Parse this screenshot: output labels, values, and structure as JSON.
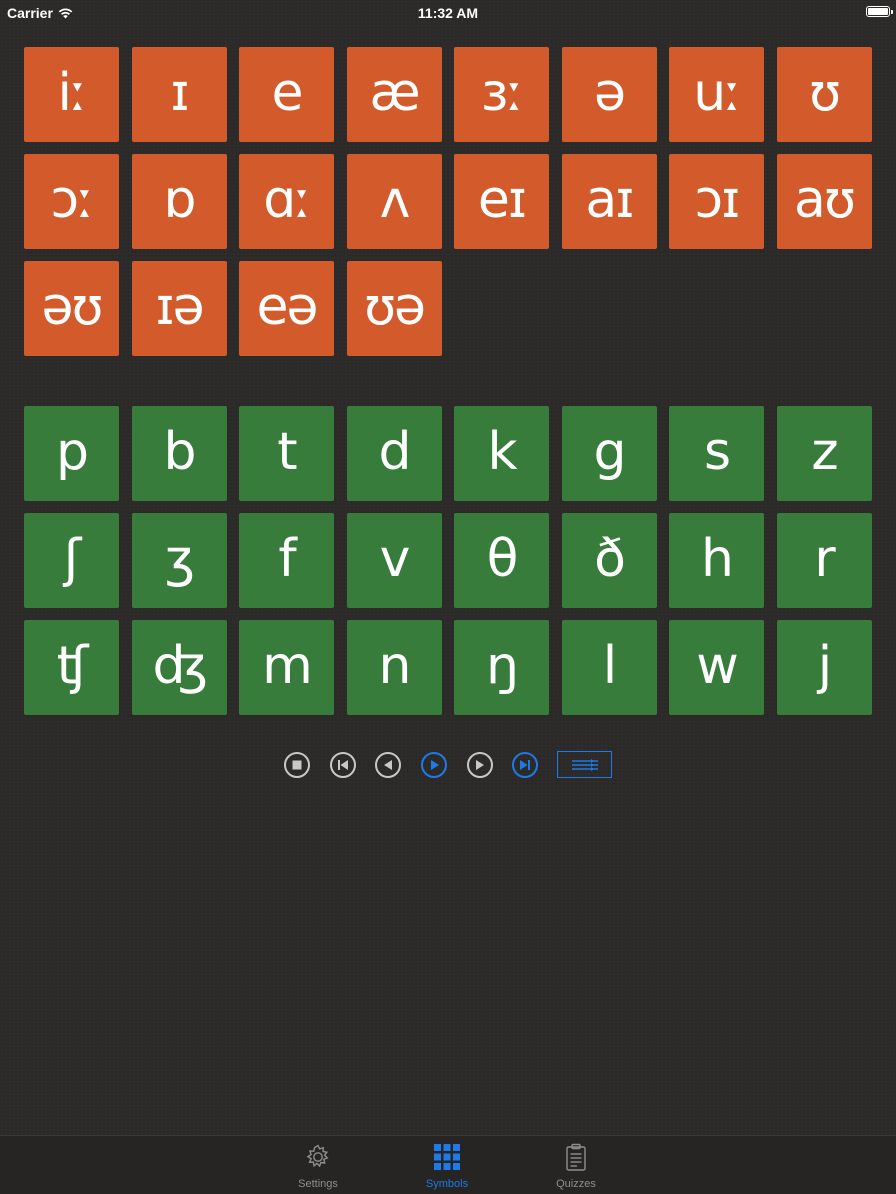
{
  "status_bar": {
    "carrier": "Carrier",
    "time": "11:32 AM"
  },
  "vowels": [
    "iː",
    "ɪ",
    "e",
    "æ",
    "ɜː",
    "ə",
    "uː",
    "ʊ",
    "ɔː",
    "ɒ",
    "ɑː",
    "ʌ",
    "eɪ",
    "aɪ",
    "ɔɪ",
    "aʊ",
    "əʊ",
    "ɪə",
    "eə",
    "ʊə"
  ],
  "consonants": [
    "p",
    "b",
    "t",
    "d",
    "k",
    "g",
    "s",
    "z",
    "ʃ",
    "ʒ",
    "f",
    "v",
    "θ",
    "ð",
    "h",
    "r",
    "ʧ",
    "ʤ",
    "m",
    "n",
    "ŋ",
    "l",
    "w",
    "j"
  ],
  "controls": [
    {
      "name": "stop-icon",
      "state": "inactive"
    },
    {
      "name": "skip-to-start-icon",
      "state": "inactive"
    },
    {
      "name": "previous-icon",
      "state": "inactive"
    },
    {
      "name": "play-icon",
      "state": "active"
    },
    {
      "name": "next-icon",
      "state": "inactive"
    },
    {
      "name": "skip-to-end-icon",
      "state": "active"
    },
    {
      "name": "list-settings-icon",
      "state": "active"
    }
  ],
  "tab_bar": {
    "tabs": [
      {
        "label": "Settings",
        "icon": "gear-icon",
        "active": false
      },
      {
        "label": "Symbols",
        "icon": "grid-icon",
        "active": true
      },
      {
        "label": "Quizzes",
        "icon": "clipboard-icon",
        "active": false
      }
    ]
  },
  "colors": {
    "vowel": "#d35a2a",
    "consonant": "#387c3c",
    "accent": "#1d7ae8",
    "background": "#2d2b29"
  }
}
